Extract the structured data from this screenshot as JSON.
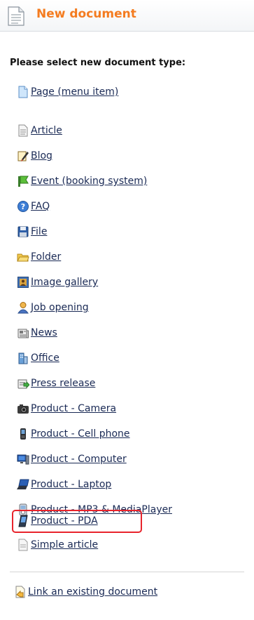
{
  "header": {
    "title": "New document",
    "icon": "document-icon"
  },
  "prompt": "Please select new document type:",
  "types": [
    {
      "label": "Page (menu item)",
      "icon": "page-icon"
    },
    {
      "label": "Article",
      "icon": "article-icon"
    },
    {
      "label": "Blog",
      "icon": "blog-icon"
    },
    {
      "label": "Event (booking system)",
      "icon": "event-icon"
    },
    {
      "label": "FAQ",
      "icon": "faq-icon"
    },
    {
      "label": "File",
      "icon": "file-icon"
    },
    {
      "label": "Folder",
      "icon": "folder-icon"
    },
    {
      "label": "Image gallery",
      "icon": "image-gallery-icon"
    },
    {
      "label": "Job opening",
      "icon": "job-opening-icon"
    },
    {
      "label": "News",
      "icon": "news-icon"
    },
    {
      "label": "Office",
      "icon": "office-icon"
    },
    {
      "label": "Press release",
      "icon": "press-release-icon"
    },
    {
      "label": "Product - Camera",
      "icon": "camera-icon"
    },
    {
      "label": "Product - Cell phone",
      "icon": "cell-phone-icon"
    },
    {
      "label": "Product - Computer",
      "icon": "computer-icon"
    },
    {
      "label": "Product - Laptop",
      "icon": "laptop-icon"
    },
    {
      "label": "Product - MP3 & MediaPlayer",
      "icon": "mp3-player-icon"
    },
    {
      "label": "Product - PDA",
      "icon": "pda-icon"
    },
    {
      "label": "Simple article",
      "icon": "simple-article-icon"
    }
  ],
  "highlighted": "Product - PDA",
  "highlight_color": "#e8242c",
  "title_color": "#f47c20",
  "link_color": "#1a2a55",
  "footer_link": {
    "label": "Link an existing document",
    "icon": "link-document-icon"
  }
}
